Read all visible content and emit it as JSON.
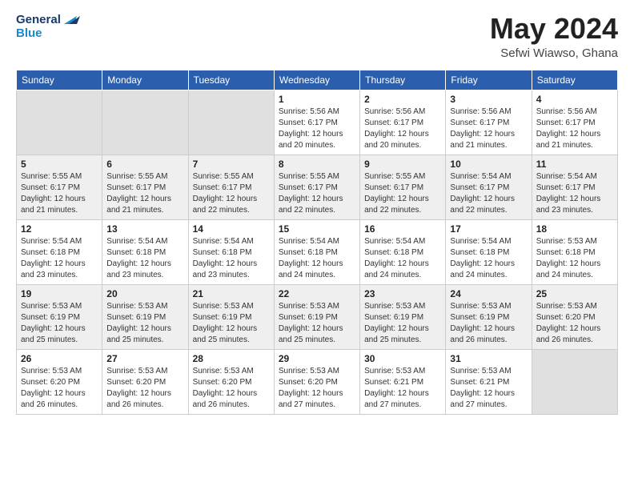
{
  "header": {
    "logo_line1": "General",
    "logo_line2": "Blue",
    "month_year": "May 2024",
    "location": "Sefwi Wiawso, Ghana"
  },
  "weekdays": [
    "Sunday",
    "Monday",
    "Tuesday",
    "Wednesday",
    "Thursday",
    "Friday",
    "Saturday"
  ],
  "weeks": [
    [
      {
        "day": "",
        "info": ""
      },
      {
        "day": "",
        "info": ""
      },
      {
        "day": "",
        "info": ""
      },
      {
        "day": "1",
        "info": "Sunrise: 5:56 AM\nSunset: 6:17 PM\nDaylight: 12 hours\nand 20 minutes."
      },
      {
        "day": "2",
        "info": "Sunrise: 5:56 AM\nSunset: 6:17 PM\nDaylight: 12 hours\nand 20 minutes."
      },
      {
        "day": "3",
        "info": "Sunrise: 5:56 AM\nSunset: 6:17 PM\nDaylight: 12 hours\nand 21 minutes."
      },
      {
        "day": "4",
        "info": "Sunrise: 5:56 AM\nSunset: 6:17 PM\nDaylight: 12 hours\nand 21 minutes."
      }
    ],
    [
      {
        "day": "5",
        "info": "Sunrise: 5:55 AM\nSunset: 6:17 PM\nDaylight: 12 hours\nand 21 minutes."
      },
      {
        "day": "6",
        "info": "Sunrise: 5:55 AM\nSunset: 6:17 PM\nDaylight: 12 hours\nand 21 minutes."
      },
      {
        "day": "7",
        "info": "Sunrise: 5:55 AM\nSunset: 6:17 PM\nDaylight: 12 hours\nand 22 minutes."
      },
      {
        "day": "8",
        "info": "Sunrise: 5:55 AM\nSunset: 6:17 PM\nDaylight: 12 hours\nand 22 minutes."
      },
      {
        "day": "9",
        "info": "Sunrise: 5:55 AM\nSunset: 6:17 PM\nDaylight: 12 hours\nand 22 minutes."
      },
      {
        "day": "10",
        "info": "Sunrise: 5:54 AM\nSunset: 6:17 PM\nDaylight: 12 hours\nand 22 minutes."
      },
      {
        "day": "11",
        "info": "Sunrise: 5:54 AM\nSunset: 6:17 PM\nDaylight: 12 hours\nand 23 minutes."
      }
    ],
    [
      {
        "day": "12",
        "info": "Sunrise: 5:54 AM\nSunset: 6:18 PM\nDaylight: 12 hours\nand 23 minutes."
      },
      {
        "day": "13",
        "info": "Sunrise: 5:54 AM\nSunset: 6:18 PM\nDaylight: 12 hours\nand 23 minutes."
      },
      {
        "day": "14",
        "info": "Sunrise: 5:54 AM\nSunset: 6:18 PM\nDaylight: 12 hours\nand 23 minutes."
      },
      {
        "day": "15",
        "info": "Sunrise: 5:54 AM\nSunset: 6:18 PM\nDaylight: 12 hours\nand 24 minutes."
      },
      {
        "day": "16",
        "info": "Sunrise: 5:54 AM\nSunset: 6:18 PM\nDaylight: 12 hours\nand 24 minutes."
      },
      {
        "day": "17",
        "info": "Sunrise: 5:54 AM\nSunset: 6:18 PM\nDaylight: 12 hours\nand 24 minutes."
      },
      {
        "day": "18",
        "info": "Sunrise: 5:53 AM\nSunset: 6:18 PM\nDaylight: 12 hours\nand 24 minutes."
      }
    ],
    [
      {
        "day": "19",
        "info": "Sunrise: 5:53 AM\nSunset: 6:19 PM\nDaylight: 12 hours\nand 25 minutes."
      },
      {
        "day": "20",
        "info": "Sunrise: 5:53 AM\nSunset: 6:19 PM\nDaylight: 12 hours\nand 25 minutes."
      },
      {
        "day": "21",
        "info": "Sunrise: 5:53 AM\nSunset: 6:19 PM\nDaylight: 12 hours\nand 25 minutes."
      },
      {
        "day": "22",
        "info": "Sunrise: 5:53 AM\nSunset: 6:19 PM\nDaylight: 12 hours\nand 25 minutes."
      },
      {
        "day": "23",
        "info": "Sunrise: 5:53 AM\nSunset: 6:19 PM\nDaylight: 12 hours\nand 25 minutes."
      },
      {
        "day": "24",
        "info": "Sunrise: 5:53 AM\nSunset: 6:19 PM\nDaylight: 12 hours\nand 26 minutes."
      },
      {
        "day": "25",
        "info": "Sunrise: 5:53 AM\nSunset: 6:20 PM\nDaylight: 12 hours\nand 26 minutes."
      }
    ],
    [
      {
        "day": "26",
        "info": "Sunrise: 5:53 AM\nSunset: 6:20 PM\nDaylight: 12 hours\nand 26 minutes."
      },
      {
        "day": "27",
        "info": "Sunrise: 5:53 AM\nSunset: 6:20 PM\nDaylight: 12 hours\nand 26 minutes."
      },
      {
        "day": "28",
        "info": "Sunrise: 5:53 AM\nSunset: 6:20 PM\nDaylight: 12 hours\nand 26 minutes."
      },
      {
        "day": "29",
        "info": "Sunrise: 5:53 AM\nSunset: 6:20 PM\nDaylight: 12 hours\nand 27 minutes."
      },
      {
        "day": "30",
        "info": "Sunrise: 5:53 AM\nSunset: 6:21 PM\nDaylight: 12 hours\nand 27 minutes."
      },
      {
        "day": "31",
        "info": "Sunrise: 5:53 AM\nSunset: 6:21 PM\nDaylight: 12 hours\nand 27 minutes."
      },
      {
        "day": "",
        "info": ""
      }
    ]
  ]
}
